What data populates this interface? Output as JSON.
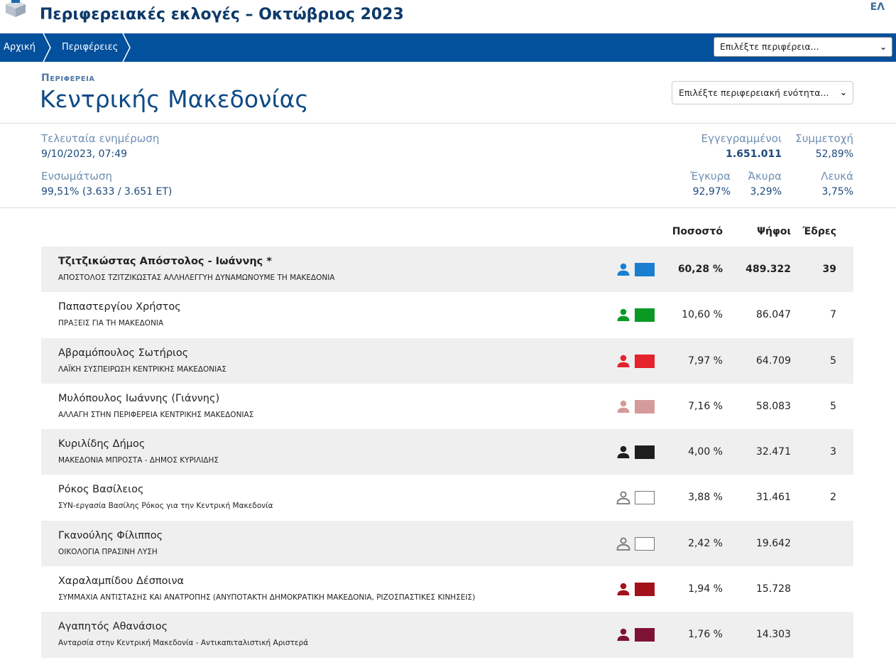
{
  "header": {
    "title": "Περιφερειακές εκλογές – Οκτώβριος 2023",
    "language": "ΕΛ"
  },
  "nav": {
    "breadcrumbs": [
      "Αρχική",
      "Περιφέρειες"
    ],
    "region_select": "Επιλέξτε περιφέρεια..."
  },
  "region": {
    "subheading": "Περιφερεια",
    "title": "Κεντρικής Μακεδονίας",
    "unit_select": "Επιλέξτε περιφερειακή ενότητα..."
  },
  "stats": {
    "last_update_label": "Τελευταία ενημέρωση",
    "last_update_value": "9/10/2023, 07:49",
    "integration_label": "Ενσωμάτωση",
    "integration_value": "99,51% (3.633 / 3.651 ΕΤ)",
    "registered_label": "Εγγεγραμμένοι",
    "registered_value": "1.651.011",
    "turnout_label": "Συμμετοχή",
    "turnout_value": "52,89%",
    "valid_label": "Έγκυρα",
    "valid_value": "92,97%",
    "invalid_label": "Άκυρα",
    "invalid_value": "3,29%",
    "blank_label": "Λευκά",
    "blank_value": "3,75%"
  },
  "table": {
    "headers": {
      "percent": "Ποσοστό",
      "votes": "Ψήφοι",
      "seats": "Έδρες"
    },
    "rows": [
      {
        "candidate": "Τζιτζικώστας Απόστολος - Ιωάννης *",
        "party": "ΑΠΟΣΤΟΛΟΣ ΤΖΙΤΖΙΚΩΣΤΑΣ ΑΛΛΗΛΕΓΓΥΗ ΔΥΝΑΜΩΝΟΥΜΕ ΤΗ ΜΑΚΕΔΟΝΙΑ",
        "color": "#1a7fd0",
        "percent": "60,28 %",
        "votes": "489.322",
        "seats": "39"
      },
      {
        "candidate": "Παπαστεργίου Χρήστος",
        "party": "ΠΡΑΞΕΙΣ ΓΙΑ ΤΗ ΜΑΚΕΔΟΝΙΑ",
        "color": "#0a9a24",
        "percent": "10,60 %",
        "votes": "86.047",
        "seats": "7"
      },
      {
        "candidate": "Αβραμόπουλος Σωτήριος",
        "party": "ΛΑΪΚΗ ΣΥΣΠΕΙΡΩΣΗ ΚΕΝΤΡΙΚΗΣ ΜΑΚΕΔΟΝΙΑΣ",
        "color": "#e4232c",
        "percent": "7,97 %",
        "votes": "64.709",
        "seats": "5"
      },
      {
        "candidate": "Μυλόπουλος Ιωάννης (Γιάννης)",
        "party": "ΑΛΛΑΓΗ ΣΤΗΝ ΠΕΡΙΦΕΡΕΙΑ ΚΕΝΤΡΙΚΗΣ ΜΑΚΕΔΟΝΙΑΣ",
        "color": "#d59b9b",
        "percent": "7,16 %",
        "votes": "58.083",
        "seats": "5"
      },
      {
        "candidate": "Κυριλίδης Δήμος",
        "party": "ΜΑΚΕΔΟΝΙΑ ΜΠΡΟΣΤΑ - ΔΗΜΟΣ ΚΥΡΙΛΙΔΗΣ",
        "color": "#1e1e1e",
        "percent": "4,00 %",
        "votes": "32.471",
        "seats": "3"
      },
      {
        "candidate": "Ρόκος Βασίλειος",
        "party": "ΣΥΝ-εργασία Βασίλης Ρόκος για την Κεντρική Μακεδονία",
        "color": "#ffffff",
        "percent": "3,88 %",
        "votes": "31.461",
        "seats": "2"
      },
      {
        "candidate": "Γκανούλης Φίλιππος",
        "party": "ΟΙΚΟΛΟΓΙΑ ΠΡΑΣΙΝΗ ΛΥΣΗ",
        "color": "#ffffff",
        "percent": "2,42 %",
        "votes": "19.642",
        "seats": ""
      },
      {
        "candidate": "Χαραλαμπίδου Δέσποινα",
        "party": "ΣΥΜΜΑΧΙΑ ΑΝΤΙΣΤΑΣΗΣ ΚΑΙ ΑΝΑΤΡΟΠΗΣ (ΑΝΥΠΟΤΑΚΤΗ ΔΗΜΟΚΡΑΤΙΚΗ ΜΑΚΕΔΟΝΙΑ, ΡΙΖΟΣΠΑΣΤΙΚΕΣ ΚΙΝΗΣΕΙΣ)",
        "color": "#a3121a",
        "percent": "1,94 %",
        "votes": "15.728",
        "seats": ""
      },
      {
        "candidate": "Αγαπητός Αθανάσιος",
        "party": "Ανταρσία στην Κεντρική Μακεδονία - Αντικαπιταλιστική Αριστερά",
        "color": "#7e1235",
        "percent": "1,76 %",
        "votes": "14.303",
        "seats": ""
      }
    ]
  }
}
